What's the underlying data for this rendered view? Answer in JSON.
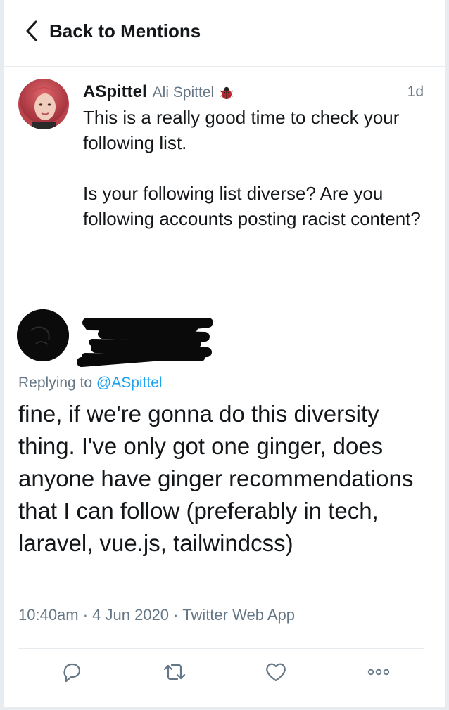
{
  "header": {
    "back_label": "Back to Mentions",
    "back_icon": "chevron-left-icon"
  },
  "original_tweet": {
    "display_name": "ASpittel",
    "handle": "Ali Spittel",
    "badge_icon": "ladybug-icon",
    "time": "1d",
    "text": "This is a really good time to check your following list.\n\nIs your following list diverse? Are you following accounts posting racist content?"
  },
  "reply_tweet": {
    "author_redacted": true,
    "replying_prefix": "Replying to",
    "replying_to": "@ASpittel",
    "text": "fine, if we're gonna do this diversity thing. I've only got one ginger, does anyone have ginger recommendations that I can follow (preferably in tech, laravel, vue.js, tailwindcss)",
    "meta": "10:40am · 4 Jun 2020 · Twitter Web App"
  },
  "actions": [
    {
      "icon": "reply-icon"
    },
    {
      "icon": "retweet-icon"
    },
    {
      "icon": "like-icon"
    },
    {
      "icon": "more-icon"
    }
  ],
  "colors": {
    "text": "#14171a",
    "secondary": "#657786",
    "link": "#1da1f2",
    "border": "#e6ecf0"
  }
}
